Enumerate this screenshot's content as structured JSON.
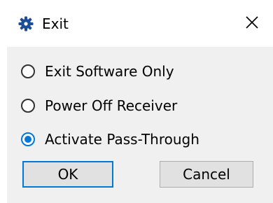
{
  "window": {
    "title": "Exit",
    "icon": "gear-icon",
    "close_glyph": "✕"
  },
  "options": [
    {
      "label": "Exit Software Only",
      "checked": false
    },
    {
      "label": "Power Off Receiver",
      "checked": false
    },
    {
      "label": "Activate Pass-Through",
      "checked": true
    }
  ],
  "buttons": {
    "ok_label": "OK",
    "cancel_label": "Cancel"
  },
  "colors": {
    "accent": "#0078d7",
    "dialog_body": "#f0f0f0",
    "button_face": "#e1e1e1",
    "icon_blue": "#1f4e99"
  }
}
